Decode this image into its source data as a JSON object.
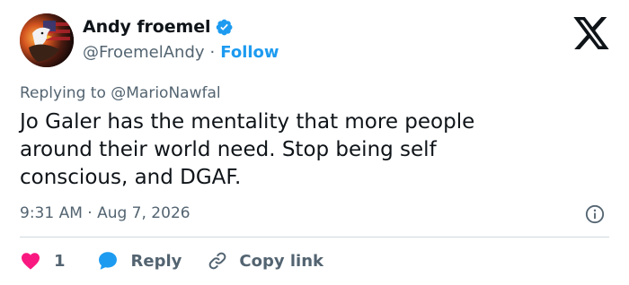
{
  "author": {
    "name": "Andy froemel",
    "handle": "@FroemelAndy",
    "separator": "·",
    "follow_label": "Follow",
    "avatar_icon": "eagle-flag-avatar-icon",
    "verified_icon": "verified-badge-icon"
  },
  "brand": {
    "logo_icon": "x-logo-icon"
  },
  "reply_context": {
    "prefix": "Replying to ",
    "mention": "@MarioNawfal"
  },
  "tweet": {
    "text": "Jo Galer has the mentality that more people\naround their world need. Stop being self\nconscious, and DGAF.",
    "timestamp": "9:31 AM · Aug 7, 2026"
  },
  "actions": {
    "like_count": "1",
    "reply_label": "Reply",
    "copy_label": "Copy link"
  },
  "colors": {
    "accent": "#1d9bf0",
    "like": "#f91880",
    "muted": "#536471",
    "text": "#0f1419"
  }
}
